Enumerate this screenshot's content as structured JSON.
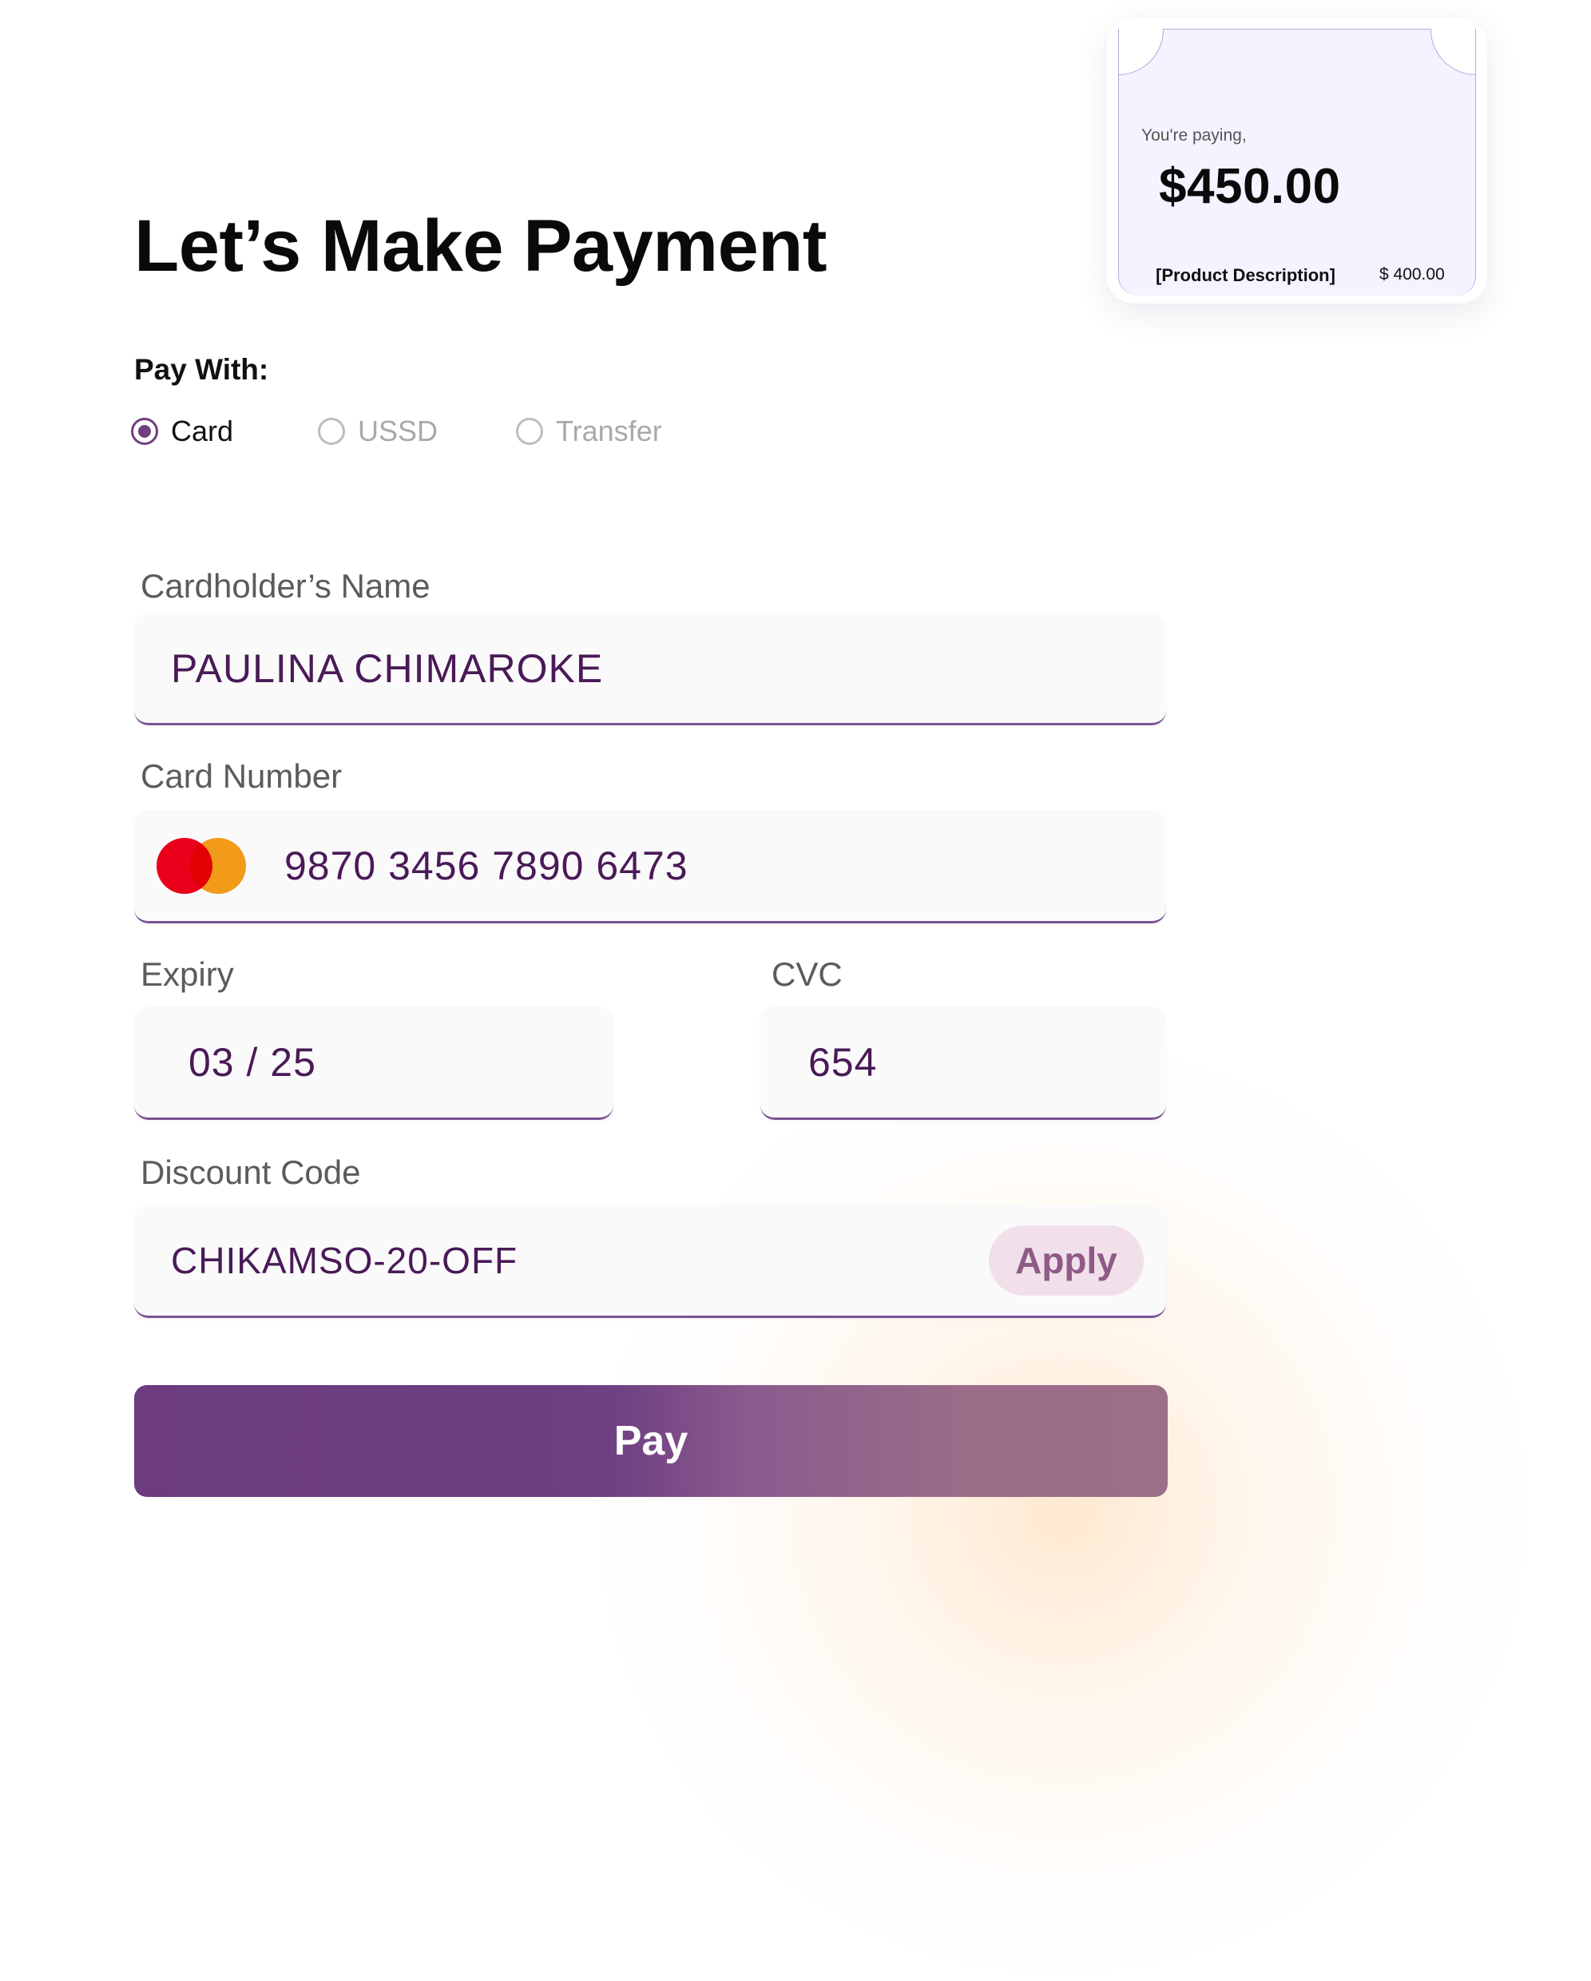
{
  "summary": {
    "paying_label": "You're paying,",
    "amount": "$450.00",
    "product_description": "[Product Description]",
    "product_price": "$ 400.00"
  },
  "page_title": "Let’s Make Payment",
  "pay_with": {
    "label": "Pay With:",
    "options": [
      {
        "label": "Card",
        "selected": true
      },
      {
        "label": "USSD",
        "selected": false
      },
      {
        "label": "Transfer",
        "selected": false
      }
    ]
  },
  "form": {
    "cardholder_name": {
      "label": "Cardholder’s Name",
      "value": "PAULINA CHIMAROKE"
    },
    "card_number": {
      "label": "Card Number",
      "value": "9870 3456 7890 6473",
      "brand_icon": "mastercard-icon"
    },
    "expiry": {
      "label": "Expiry",
      "value": "03 / 25"
    },
    "cvc": {
      "label": "CVC",
      "value": "654"
    },
    "discount_code": {
      "label": "Discount Code",
      "value": "CHIKAMSO-20-OFF",
      "apply_label": "Apply"
    }
  },
  "pay_button_label": "Pay",
  "colors": {
    "accent": "#6f3f81",
    "input_text": "#4a1a58",
    "summary_background": "#f6f2ff",
    "apply_background": "#f1e0ea"
  }
}
